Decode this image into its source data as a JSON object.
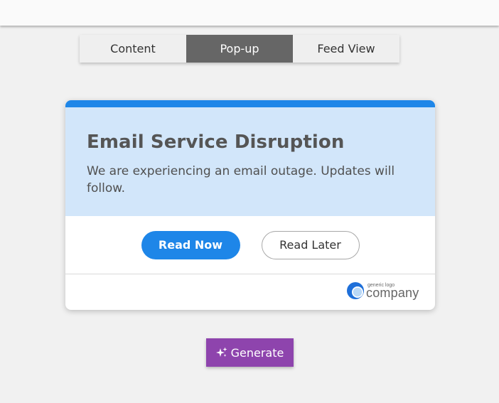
{
  "tabs": [
    {
      "label": "Content",
      "active": false
    },
    {
      "label": "Pop-up",
      "active": true
    },
    {
      "label": "Feed View",
      "active": false
    }
  ],
  "popup": {
    "title": "Email Service Disruption",
    "message": "We are experiencing an email outage. Updates will follow.",
    "primary_button": "Read Now",
    "secondary_button": "Read Later",
    "logo": {
      "small_text": "generic logo",
      "big_text": "company",
      "icon": "company-logo-icon"
    }
  },
  "generate_button": {
    "label": "Generate",
    "icon": "sparkle-icon"
  },
  "colors": {
    "accent": "#1e86e8",
    "header_bg": "#d2e6fa",
    "active_tab": "#666666",
    "generate": "#8e44ad",
    "background": "#f1f1f1"
  }
}
